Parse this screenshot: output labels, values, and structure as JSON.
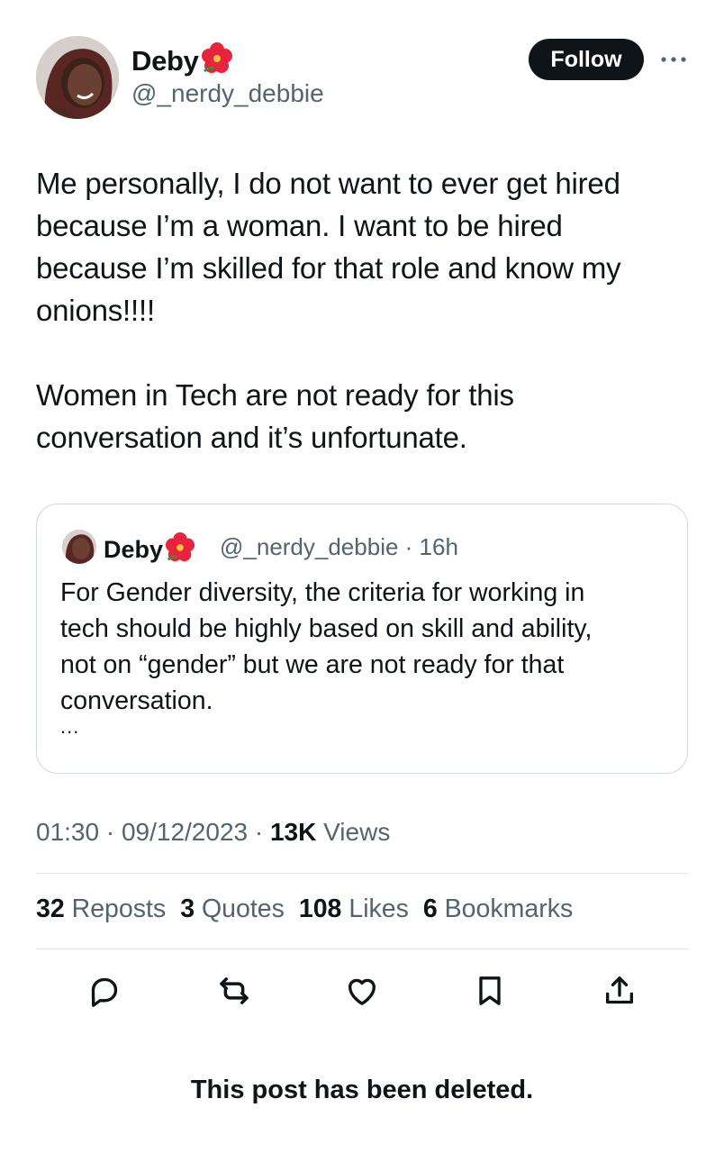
{
  "author": {
    "name": "Deby",
    "emoji": "hibiscus-flower",
    "handle": "@_nerdy_debbie",
    "avatar": "profile-photo"
  },
  "follow_label": "Follow",
  "more_icon": "more-horizontal-icon",
  "post_text": "Me personally, I do not want to ever get hired\nbecause I’m a woman. I want to be hired\nbecause I’m skilled for that role and know my\nonions!!!!\n\nWomen in Tech are not ready for this\nconversation and it’s unfortunate.",
  "quoted": {
    "name": "Deby",
    "handle_time": "@_nerdy_debbie · 16h",
    "text": "For Gender diversity, the criteria for working in\ntech should be highly based on skill and ability,\nnot on “gender” but we are not ready for that\nconversation.",
    "ellipsis": "..."
  },
  "meta": {
    "time_date": "01:30 · 09/12/2023 · ",
    "views_count": "13K",
    "views_label": " Views"
  },
  "stats": [
    {
      "count": "32",
      "label": "Reposts"
    },
    {
      "count": "3",
      "label": "Quotes"
    },
    {
      "count": "108",
      "label": "Likes"
    },
    {
      "count": "6",
      "label": "Bookmarks"
    }
  ],
  "actions": [
    "reply-icon",
    "repost-icon",
    "like-icon",
    "bookmark-icon",
    "share-icon"
  ],
  "deleted_notice": "This post has been deleted.",
  "colors": {
    "text": "#0f1419",
    "secondary": "#536471",
    "border": "#cfd9de",
    "divider": "#e1e6ea"
  }
}
